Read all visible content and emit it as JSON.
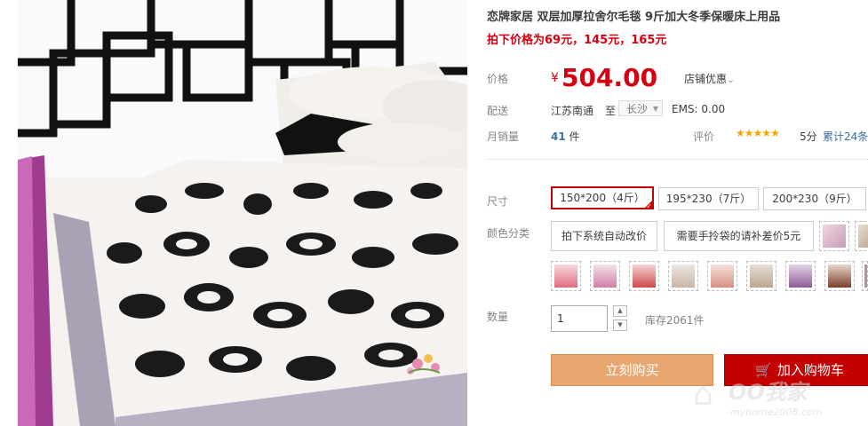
{
  "product": {
    "title": "恋牌家居 双层加厚拉舍尔毛毯 9斤加大冬季保暖床上用品",
    "subtitle": "拍下价格为69元，145元，165元",
    "image_alt": "leopard-print blanket on bed"
  },
  "price": {
    "label": "价格",
    "currency": "¥",
    "value": "504.00",
    "promo": "店铺优惠",
    "promo_arrow": "⌄"
  },
  "shipping": {
    "label": "配送",
    "from": "江苏南通",
    "to_word": "至",
    "city": "长沙",
    "city_arrow": "▼",
    "ems": "EMS: 0.00"
  },
  "sales": {
    "label": "月销量",
    "count": "41",
    "unit": "件",
    "rating_label": "评价",
    "stars": "★★★★★",
    "score": "5分",
    "reviews": "累计24条"
  },
  "size": {
    "label": "尺寸",
    "options": [
      "150*200（4斤）",
      "195*230（7斤）",
      "200*230（9斤）"
    ],
    "selected_mark": "✓"
  },
  "color": {
    "label": "颜色分类",
    "options": [
      "拍下系统自动改价",
      "需要手拎袋的请补差价5元"
    ]
  },
  "quantity": {
    "label": "数量",
    "value": "1",
    "up": "▲",
    "down": "▼",
    "stock": "库存2061件"
  },
  "actions": {
    "buy_now": "立刻购买",
    "add_cart": "加入购物车",
    "cart_icon": "🛒"
  },
  "watermark": {
    "brand": "OO我家",
    "url": "myhome2008.com"
  },
  "colors": {
    "accent_red": "#c40000",
    "price_red": "#d6000f",
    "buy_orange": "#e8a76f"
  }
}
